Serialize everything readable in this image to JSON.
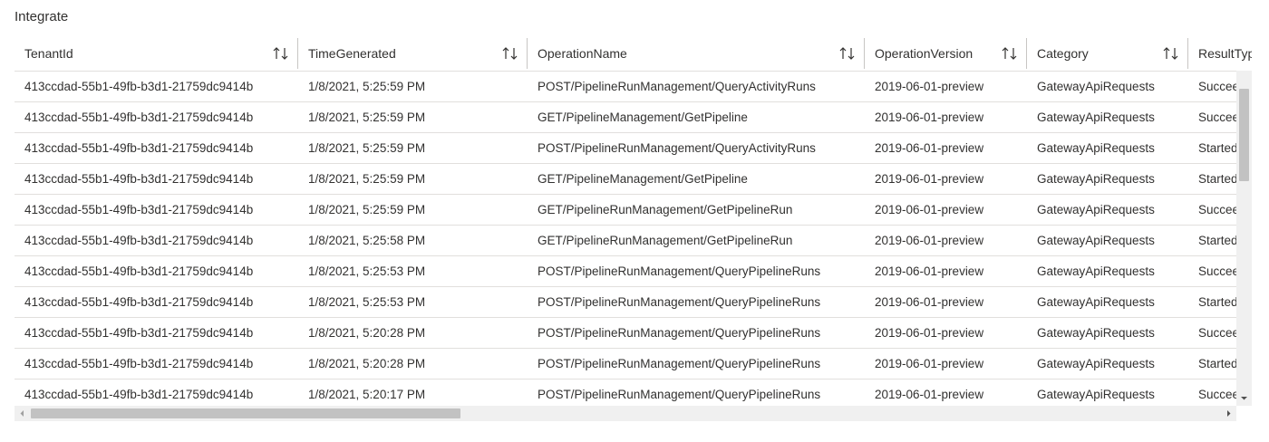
{
  "section_title": "Integrate",
  "table": {
    "columns": [
      "TenantId",
      "TimeGenerated",
      "OperationName",
      "OperationVersion",
      "Category",
      "ResultType"
    ],
    "rows": [
      [
        "413ccdad-55b1-49fb-b3d1-21759dc9414b",
        "1/8/2021, 5:25:59 PM",
        "POST/PipelineRunManagement/QueryActivityRuns",
        "2019-06-01-preview",
        "GatewayApiRequests",
        "Succeeded"
      ],
      [
        "413ccdad-55b1-49fb-b3d1-21759dc9414b",
        "1/8/2021, 5:25:59 PM",
        "GET/PipelineManagement/GetPipeline",
        "2019-06-01-preview",
        "GatewayApiRequests",
        "Succeeded"
      ],
      [
        "413ccdad-55b1-49fb-b3d1-21759dc9414b",
        "1/8/2021, 5:25:59 PM",
        "POST/PipelineRunManagement/QueryActivityRuns",
        "2019-06-01-preview",
        "GatewayApiRequests",
        "Started"
      ],
      [
        "413ccdad-55b1-49fb-b3d1-21759dc9414b",
        "1/8/2021, 5:25:59 PM",
        "GET/PipelineManagement/GetPipeline",
        "2019-06-01-preview",
        "GatewayApiRequests",
        "Started"
      ],
      [
        "413ccdad-55b1-49fb-b3d1-21759dc9414b",
        "1/8/2021, 5:25:59 PM",
        "GET/PipelineRunManagement/GetPipelineRun",
        "2019-06-01-preview",
        "GatewayApiRequests",
        "Succeeded"
      ],
      [
        "413ccdad-55b1-49fb-b3d1-21759dc9414b",
        "1/8/2021, 5:25:58 PM",
        "GET/PipelineRunManagement/GetPipelineRun",
        "2019-06-01-preview",
        "GatewayApiRequests",
        "Started"
      ],
      [
        "413ccdad-55b1-49fb-b3d1-21759dc9414b",
        "1/8/2021, 5:25:53 PM",
        "POST/PipelineRunManagement/QueryPipelineRuns",
        "2019-06-01-preview",
        "GatewayApiRequests",
        "Succeeded"
      ],
      [
        "413ccdad-55b1-49fb-b3d1-21759dc9414b",
        "1/8/2021, 5:25:53 PM",
        "POST/PipelineRunManagement/QueryPipelineRuns",
        "2019-06-01-preview",
        "GatewayApiRequests",
        "Started"
      ],
      [
        "413ccdad-55b1-49fb-b3d1-21759dc9414b",
        "1/8/2021, 5:20:28 PM",
        "POST/PipelineRunManagement/QueryPipelineRuns",
        "2019-06-01-preview",
        "GatewayApiRequests",
        "Succeeded"
      ],
      [
        "413ccdad-55b1-49fb-b3d1-21759dc9414b",
        "1/8/2021, 5:20:28 PM",
        "POST/PipelineRunManagement/QueryPipelineRuns",
        "2019-06-01-preview",
        "GatewayApiRequests",
        "Started"
      ],
      [
        "413ccdad-55b1-49fb-b3d1-21759dc9414b",
        "1/8/2021, 5:20:17 PM",
        "POST/PipelineRunManagement/QueryPipelineRuns",
        "2019-06-01-preview",
        "GatewayApiRequests",
        "Succeeded"
      ]
    ]
  },
  "icons": {
    "sort": "sort-arrows-icon",
    "scroll_up": "scroll-up-icon",
    "scroll_down": "scroll-down-icon",
    "scroll_left": "scroll-left-icon",
    "scroll_right": "scroll-right-icon"
  },
  "colors": {
    "text": "#323130",
    "divider": "#c8c6c4",
    "row_border": "#e1dfdd",
    "scrollbar_track": "#f0f0f0",
    "scrollbar_thumb": "#c2c2c2"
  }
}
